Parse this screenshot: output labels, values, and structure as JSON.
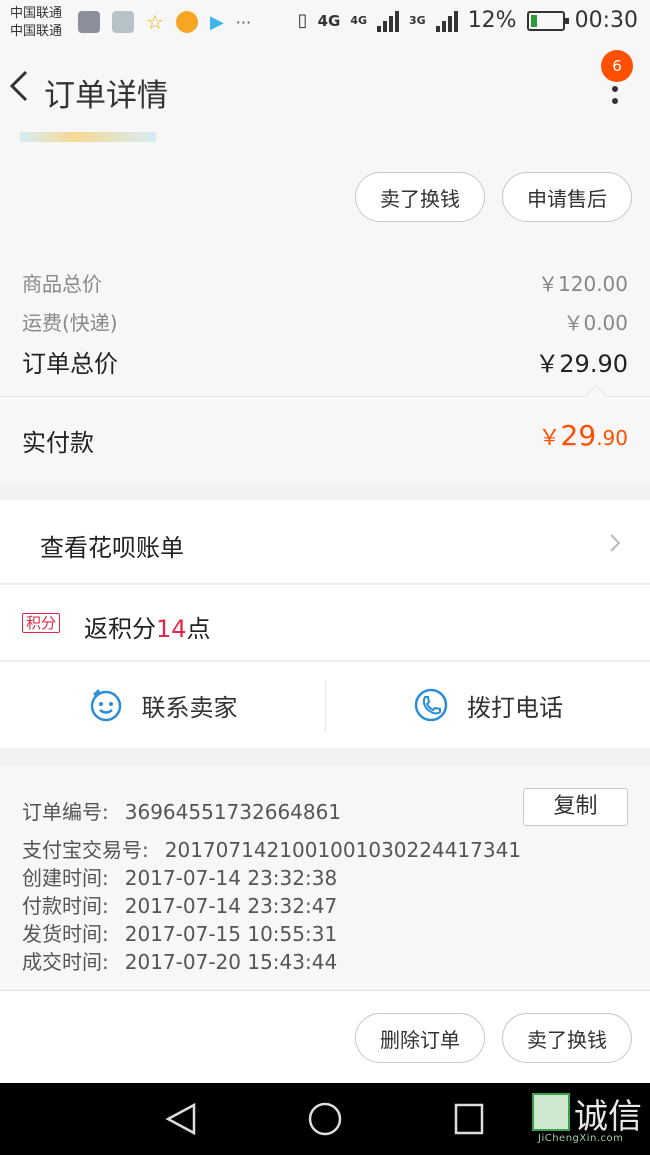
{
  "status_bar": {
    "carrier_1": "中国联通",
    "carrier_2": "中国联通",
    "notification_more": "···",
    "network_1": "4G",
    "network_2": "4G",
    "network_3": "3G",
    "battery_percent": "12%",
    "time": "00:30"
  },
  "header": {
    "title": "订单详情",
    "badge_count": "6"
  },
  "top_actions": {
    "sell_label": "卖了换钱",
    "after_sale_label": "申请售后"
  },
  "price": {
    "goods_total_label": "商品总价",
    "goods_total_value": "￥120.00",
    "shipping_label": "运费(快递)",
    "shipping_value": "￥0.00",
    "order_total_label": "订单总价",
    "order_total_value": "￥29.90",
    "paid_label": "实付款",
    "paid_currency": "￥",
    "paid_integer": "29",
    "paid_decimal": ".90"
  },
  "huabei": {
    "label": "查看花呗账单"
  },
  "points": {
    "tag": "积分",
    "prefix": "返积分",
    "count": "14",
    "suffix": "点"
  },
  "contact": {
    "seller_label": "联系卖家",
    "call_label": "拨打电话"
  },
  "order_info": {
    "order_no_label": "订单编号:",
    "order_no_value": "36964551732664861",
    "copy_label": "复制",
    "alipay_label": "支付宝交易号:",
    "alipay_value": "2017071421001001030224417341",
    "created_label": "创建时间:",
    "created_value": "2017-07-14 23:32:38",
    "paid_label": "付款时间:",
    "paid_value": "2017-07-14 23:32:47",
    "shipped_label": "发货时间:",
    "shipped_value": "2017-07-15 10:55:31",
    "closed_label": "成交时间:",
    "closed_value": "2017-07-20 15:43:44"
  },
  "bottom_actions": {
    "delete_label": "删除订单",
    "sell_label": "卖了换钱"
  },
  "watermark": {
    "text": "诚信",
    "sub": "JiChengXin.com"
  },
  "colors": {
    "accent": "#ff5000",
    "points_red": "#e0294a",
    "link_blue": "#2a8fd8"
  }
}
